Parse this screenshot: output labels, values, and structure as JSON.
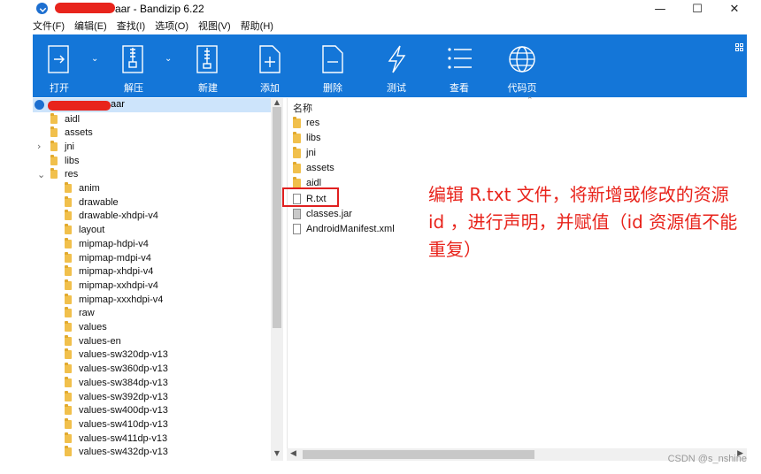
{
  "window": {
    "title": "aar - Bandizip 6.22",
    "controls": [
      "—",
      "☐",
      "✕"
    ]
  },
  "menu": [
    "文件(F)",
    "编辑(E)",
    "查找(I)",
    "选项(O)",
    "视图(V)",
    "帮助(H)"
  ],
  "toolbar": {
    "buttons": [
      {
        "label": "打开",
        "icon": "open-icon"
      },
      {
        "label": "解压",
        "icon": "extract-icon"
      },
      {
        "label": "新建",
        "icon": "new-archive-icon"
      },
      {
        "label": "添加",
        "icon": "add-file-icon"
      },
      {
        "label": "删除",
        "icon": "delete-file-icon"
      },
      {
        "label": "测试",
        "icon": "test-icon"
      },
      {
        "label": "查看",
        "icon": "view-icon"
      },
      {
        "label": "代码页",
        "icon": "codepage-icon"
      }
    ]
  },
  "tree": {
    "root_label": "aar",
    "items": [
      {
        "label": "aidl",
        "level": 1,
        "expander": ""
      },
      {
        "label": "assets",
        "level": 1,
        "expander": ""
      },
      {
        "label": "jni",
        "level": 1,
        "expander": ">"
      },
      {
        "label": "libs",
        "level": 1,
        "expander": ""
      },
      {
        "label": "res",
        "level": 1,
        "expander": "v"
      },
      {
        "label": "anim",
        "level": 2,
        "expander": ""
      },
      {
        "label": "drawable",
        "level": 2,
        "expander": ""
      },
      {
        "label": "drawable-xhdpi-v4",
        "level": 2,
        "expander": ""
      },
      {
        "label": "layout",
        "level": 2,
        "expander": ""
      },
      {
        "label": "mipmap-hdpi-v4",
        "level": 2,
        "expander": ""
      },
      {
        "label": "mipmap-mdpi-v4",
        "level": 2,
        "expander": ""
      },
      {
        "label": "mipmap-xhdpi-v4",
        "level": 2,
        "expander": ""
      },
      {
        "label": "mipmap-xxhdpi-v4",
        "level": 2,
        "expander": ""
      },
      {
        "label": "mipmap-xxxhdpi-v4",
        "level": 2,
        "expander": ""
      },
      {
        "label": "raw",
        "level": 2,
        "expander": ""
      },
      {
        "label": "values",
        "level": 2,
        "expander": ""
      },
      {
        "label": "values-en",
        "level": 2,
        "expander": ""
      },
      {
        "label": "values-sw320dp-v13",
        "level": 2,
        "expander": ""
      },
      {
        "label": "values-sw360dp-v13",
        "level": 2,
        "expander": ""
      },
      {
        "label": "values-sw384dp-v13",
        "level": 2,
        "expander": ""
      },
      {
        "label": "values-sw392dp-v13",
        "level": 2,
        "expander": ""
      },
      {
        "label": "values-sw400dp-v13",
        "level": 2,
        "expander": ""
      },
      {
        "label": "values-sw410dp-v13",
        "level": 2,
        "expander": ""
      },
      {
        "label": "values-sw411dp-v13",
        "level": 2,
        "expander": ""
      },
      {
        "label": "values-sw432dp-v13",
        "level": 2,
        "expander": ""
      }
    ]
  },
  "file_list": {
    "column_header": "名称",
    "items": [
      {
        "name": "res",
        "type": "folder"
      },
      {
        "name": "libs",
        "type": "folder"
      },
      {
        "name": "jni",
        "type": "folder"
      },
      {
        "name": "assets",
        "type": "folder"
      },
      {
        "name": "aidl",
        "type": "folder"
      },
      {
        "name": "R.txt",
        "type": "file"
      },
      {
        "name": "classes.jar",
        "type": "jar"
      },
      {
        "name": "AndroidManifest.xml",
        "type": "file"
      }
    ]
  },
  "annotation": "编辑 R.txt 文件，将新增或修改的资源 id ，进行声明，并赋值（id 资源值不能重复）",
  "watermark": "CSDN @s_nshine",
  "colors": {
    "toolbar_bg": "#1476d8",
    "selection_bg": "#cde4fb",
    "annotation_red": "#e8241c",
    "folder_yellow": "#f1c04c"
  }
}
